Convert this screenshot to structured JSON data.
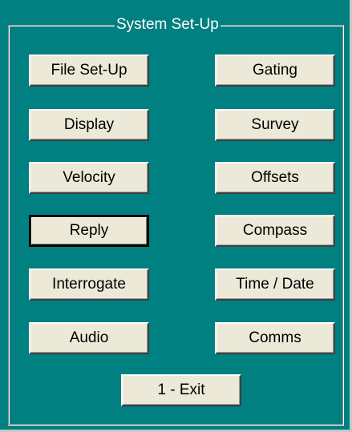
{
  "group": {
    "title": "System Set-Up"
  },
  "buttons": {
    "file_setup": "File Set-Up",
    "display": "Display",
    "velocity": "Velocity",
    "reply": "Reply",
    "interrogate": "Interrogate",
    "audio": "Audio",
    "gating": "Gating",
    "survey": "Survey",
    "offsets": "Offsets",
    "compass": "Compass",
    "time_date": "Time / Date",
    "comms": "Comms",
    "exit": "1 - Exit"
  },
  "focused_button": "reply",
  "colors": {
    "background": "#008080",
    "button_face": "#ece9d8",
    "label_text": "#ffffff"
  }
}
